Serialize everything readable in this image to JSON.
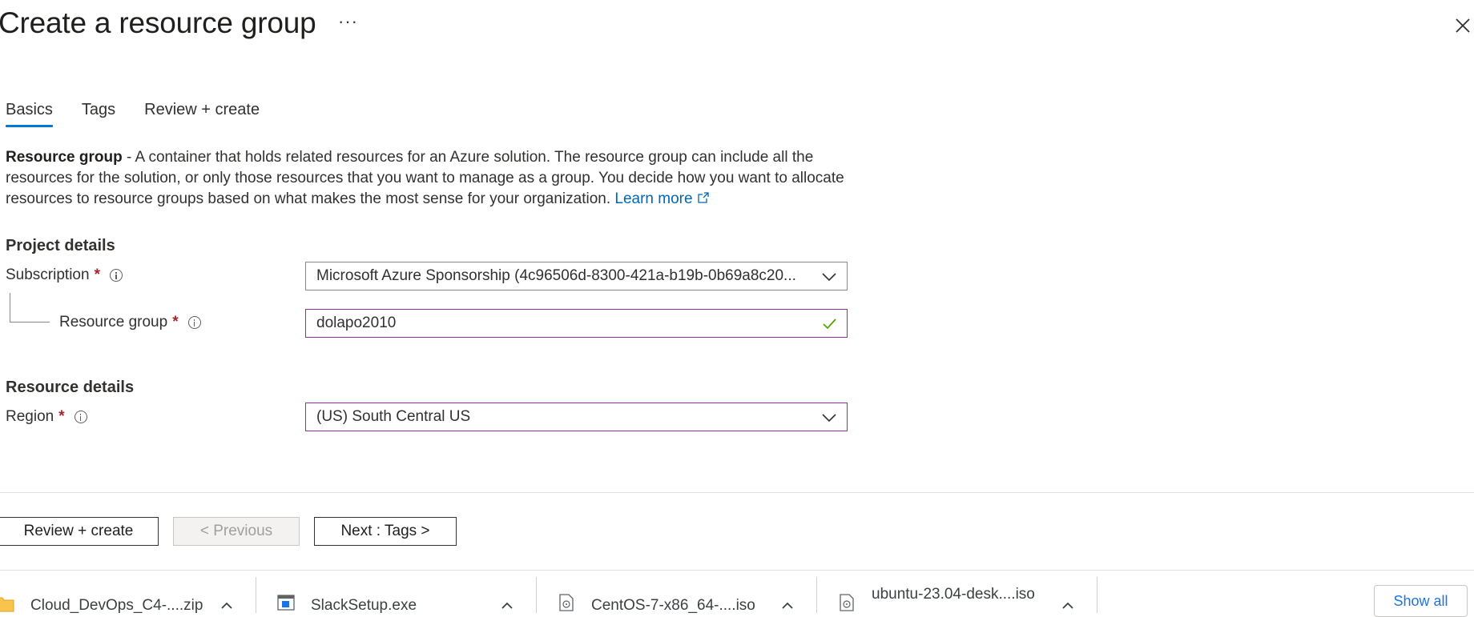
{
  "header": {
    "title": "Create a resource group",
    "more_label": "···"
  },
  "tabs": [
    {
      "label": "Basics",
      "active": true
    },
    {
      "label": "Tags",
      "active": false
    },
    {
      "label": "Review + create",
      "active": false
    }
  ],
  "description": {
    "bold": "Resource group",
    "text": " - A container that holds related resources for an Azure solution. The resource group can include all the resources for the solution, or only those resources that you want to manage as a group. You decide how you want to allocate resources to resource groups based on what makes the most sense for your organization. ",
    "link": "Learn more"
  },
  "project_details": {
    "heading": "Project details",
    "subscription": {
      "label": "Subscription",
      "required": "*",
      "value": "Microsoft Azure Sponsorship (4c96506d-8300-421a-b19b-0b69a8c20..."
    },
    "resource_group": {
      "label": "Resource group",
      "required": "*",
      "value": "dolapo2010"
    }
  },
  "resource_details": {
    "heading": "Resource details",
    "region": {
      "label": "Region",
      "required": "*",
      "value": "(US) South Central US"
    }
  },
  "footer": {
    "review_create": "Review + create",
    "previous": "< Previous",
    "next": "Next : Tags >"
  },
  "downloads": {
    "items": [
      {
        "name": "Cloud_DevOps_C4-....zip",
        "icon": "folder-zip-icon"
      },
      {
        "name": "SlackSetup.exe",
        "icon": "exe-icon"
      },
      {
        "name": "CentOS-7-x86_64-....iso",
        "icon": "disc-file-icon"
      },
      {
        "name": "ubuntu-23.04-desk....iso",
        "icon": "disc-file-icon"
      }
    ],
    "show_all": "Show all"
  },
  "colors": {
    "accent": "#0078d4",
    "link": "#0067b8",
    "required": "#a4262c",
    "focus_border": "#8f2ea7",
    "valid_check": "#57a300"
  }
}
